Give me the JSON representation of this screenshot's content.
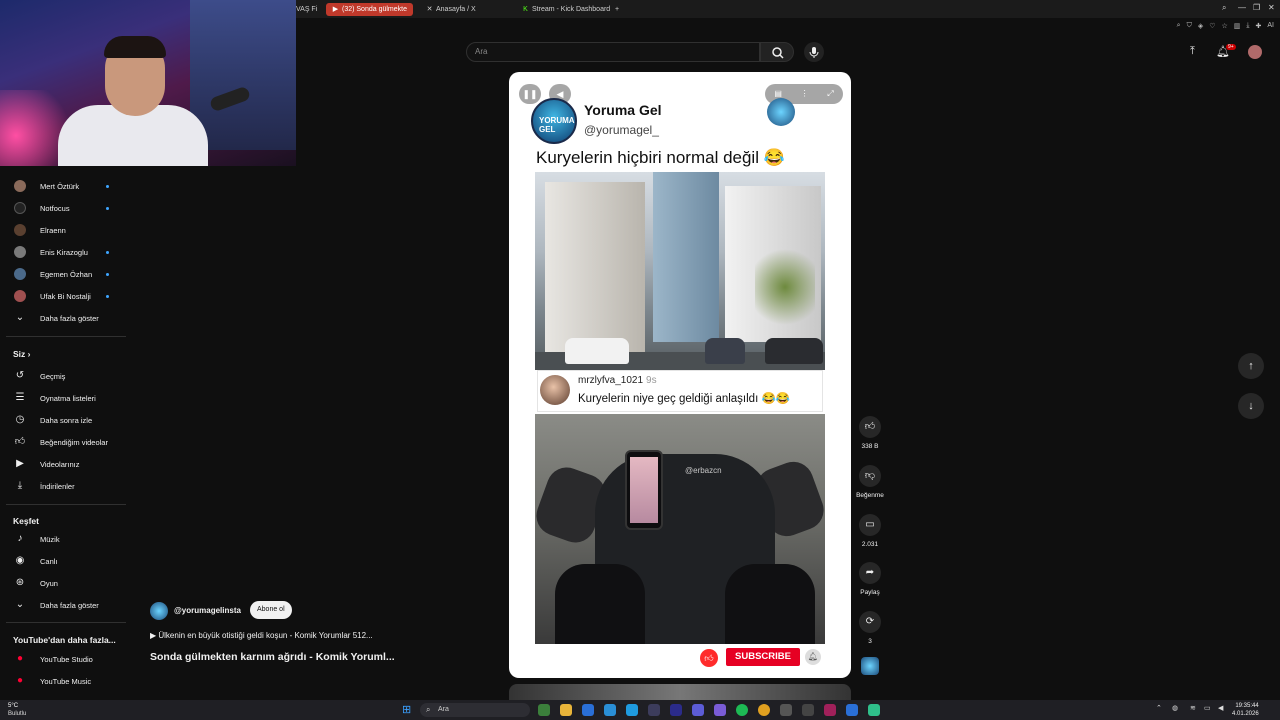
{
  "browser": {
    "tabs": [
      {
        "label": "VAŞ Fi",
        "icon": "tab-icon"
      },
      {
        "label": "(32) Sonda gülmekte",
        "icon": "youtube-icon",
        "active": true
      },
      {
        "label": "Anasayfa / X",
        "icon": "x-icon"
      },
      {
        "label": "Stream - Kick Dashboard",
        "icon": "kick-icon"
      }
    ],
    "new_tab": "+",
    "toolbar_ai": "AI"
  },
  "search": {
    "placeholder": "Ara"
  },
  "header": {
    "notification_count": "9+"
  },
  "sidebar": {
    "subscriptions": [
      {
        "label": "Mert Öztürk",
        "color": "#8a6a5a",
        "live_dot": true
      },
      {
        "label": "Notfocus",
        "color": "#222222",
        "live_dot": true
      },
      {
        "label": "Elraenn",
        "color": "#5a4030",
        "live_dot": false
      },
      {
        "label": "Enis Kirazoglu",
        "color": "#7a7a7a",
        "live_dot": true
      },
      {
        "label": "Egemen Özhan",
        "color": "#4b6a8a",
        "live_dot": true
      },
      {
        "label": "Ufak Bi Nostalji",
        "color": "#a05050",
        "live_dot": true
      }
    ],
    "show_more_1": "Daha fazla göster",
    "you_heading": "Siz",
    "you_items": [
      {
        "label": "Geçmiş",
        "icon": "history-icon"
      },
      {
        "label": "Oynatma listeleri",
        "icon": "playlist-icon"
      },
      {
        "label": "Daha sonra izle",
        "icon": "clock-icon"
      },
      {
        "label": "Beğendiğim videolar",
        "icon": "thumbs-up-icon"
      },
      {
        "label": "Videolarınız",
        "icon": "video-icon"
      },
      {
        "label": "İndirilenler",
        "icon": "download-icon"
      }
    ],
    "explore_heading": "Keşfet",
    "explore_items": [
      {
        "label": "Müzik",
        "icon": "music-icon"
      },
      {
        "label": "Canlı",
        "icon": "live-icon"
      },
      {
        "label": "Oyun",
        "icon": "gamepad-icon"
      }
    ],
    "show_more_2": "Daha fazla göster",
    "more_heading": "YouTube'dan daha fazla...",
    "more_items": [
      {
        "label": "YouTube Studio",
        "icon": "youtube-studio-icon"
      },
      {
        "label": "YouTube Music",
        "icon": "youtube-music-icon"
      }
    ]
  },
  "short": {
    "channel_name": "Yoruma Gel",
    "channel_handle": "@yorumagel_",
    "avatar_text": "YORUMA GEL",
    "headline": "Kuryelerin hiçbiri normal değil 😂",
    "comment": {
      "user": "mrzlyfva_1021",
      "time": "9s",
      "text": "Kuryelerin niye geç geldiği anlaşıldı 😂😂"
    },
    "watermark": "@erbazcn",
    "subscribe_label": "SUBSCRIBE"
  },
  "actions": {
    "like_count": "338 B",
    "dislike_label": "Beğenme",
    "comment_count": "2.031",
    "share_label": "Paylaş",
    "remix_count": "3"
  },
  "channel_row": {
    "name": "@yorumagelinsta",
    "subscribe_button": "Abone ol",
    "music_line": "▶ Ülkenin en büyük otistiği geldi koşun - Komik Yorumlar 512...",
    "video_title": "Sonda gülmekten karnım ağrıdı - Komik Yoruml..."
  },
  "taskbar": {
    "weather_temp": "5°C",
    "weather_desc": "Bulutlu",
    "search_label": "Ara",
    "time": "19:35:44",
    "date": "4.01.2026"
  },
  "colors": {
    "accent": "#ff0000",
    "background": "#0f0f0f",
    "link_blue": "#3ea6ff"
  }
}
